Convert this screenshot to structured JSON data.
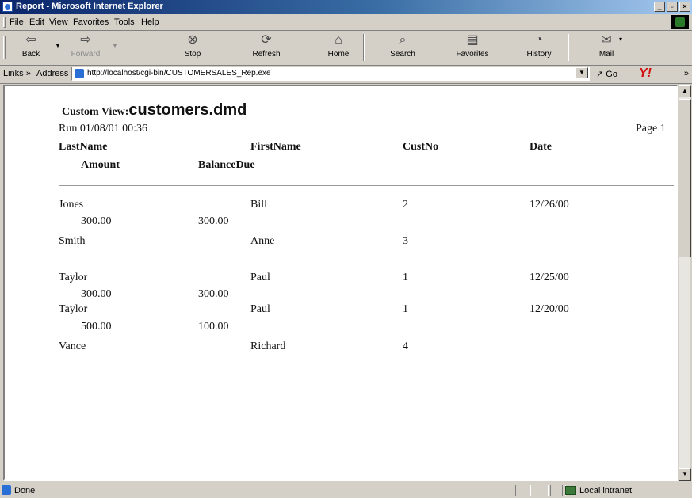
{
  "window": {
    "title": "Report - Microsoft Internet Explorer"
  },
  "menu": [
    "File",
    "Edit",
    "View",
    "Favorites",
    "Tools",
    "Help"
  ],
  "toolbar": {
    "back": "Back",
    "forward": "Forward",
    "stop": "Stop",
    "refresh": "Refresh",
    "home": "Home",
    "search": "Search",
    "favorites": "Favorites",
    "history": "History",
    "mail": "Mail"
  },
  "addressbar": {
    "links": "Links »",
    "address_label": "Address",
    "url": "http://localhost/cgi-bin/CUSTOMERSALES_Rep.exe",
    "go": "Go"
  },
  "report": {
    "custom_view_label": "Custom View:",
    "custom_view_name": "customers.dmd",
    "run": "Run 01/08/01 00:36",
    "page": "Page 1",
    "headers": {
      "lastname": "LastName",
      "firstname": "FirstName",
      "custno": "CustNo",
      "date": "Date",
      "amount": "Amount",
      "balancedue": "BalanceDue"
    },
    "rows": [
      {
        "lastname": "Jones",
        "firstname": "Bill",
        "custno": "2",
        "date": "12/26/00",
        "amount": "300.00",
        "balancedue": "300.00"
      },
      {
        "lastname": "Smith",
        "firstname": "Anne",
        "custno": "3",
        "date": "",
        "amount": "",
        "balancedue": ""
      },
      {
        "lastname": "Taylor",
        "firstname": "Paul",
        "custno": "1",
        "date": "12/25/00",
        "amount": "300.00",
        "balancedue": "300.00"
      },
      {
        "lastname": "Taylor",
        "firstname": "Paul",
        "custno": "1",
        "date": "12/20/00",
        "amount": "500.00",
        "balancedue": "100.00"
      },
      {
        "lastname": "Vance",
        "firstname": "Richard",
        "custno": "4",
        "date": "",
        "amount": "",
        "balancedue": ""
      }
    ]
  },
  "status": {
    "text": "Done",
    "zone": "Local intranet"
  },
  "icons": {
    "back": "back-arrow-icon",
    "forward": "forward-arrow-icon",
    "stop": "stop-icon",
    "refresh": "refresh-icon",
    "home": "home-icon",
    "search": "search-icon",
    "favorites": "favorites-icon",
    "history": "history-icon",
    "mail": "mail-icon"
  }
}
